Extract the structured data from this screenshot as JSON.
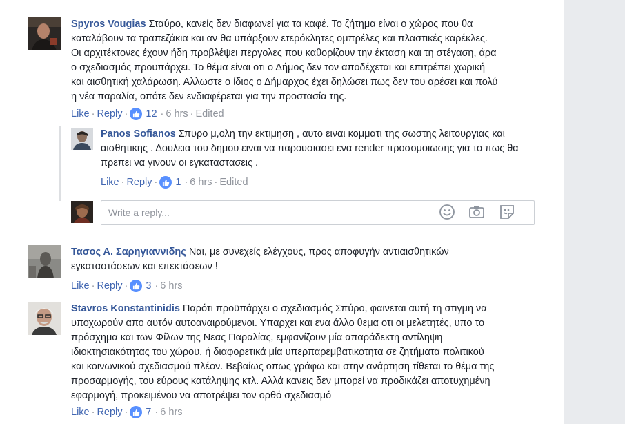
{
  "comments": [
    {
      "author": "Spyros Vougias",
      "text": "Σταύρο, κανείς δεν διαφωνεί για τα καφέ. Το ζήτημα είναι ο χώρος που θα καταλάβουν τα τραπεζάκια και αν θα υπάρξουν ετερόκλητες ομπρέλες και πλαστικές καρέκλες. Οι αρχιτέκτονες έχουν ήδη προβλέψει περγολες που καθορίζουν την έκταση και τη στέγαση, άρα ο σχεδιασμός προυπάρχει. Το θέμα είναι οτι ο Δήμος δεν τον αποδέχεται και επιτρέπει χωρική και αισθητική χαλάρωση. Αλλωστε ο ίδιος ο Δήμαρχος έχει δηλώσει πως δεν του αρέσει και πολύ η νέα παραλία, οπότε δεν ενδιαφέρεται για την προστασία της.",
      "like": "Like",
      "reply": "Reply",
      "likes": "12",
      "time": "6 hrs",
      "edited": "Edited"
    },
    {
      "author": "Panos Sofianos",
      "text": "Σπυρο μ,ολη την εκτιμηση , αυτο ειναι κομματι της σωστης λειτουργιας και αισθητικης . Δουλεια του δημου ειναι να παρουσιασει ενα render προσομοιωσης για το πως θα πρεπει να γινουν οι εγκαταστασεις .",
      "like": "Like",
      "reply": "Reply",
      "likes": "1",
      "time": "6 hrs",
      "edited": "Edited"
    },
    {
      "author": "Τασος Α. Σαρηγιαννιδης",
      "text": "Ναι, με συνεχείς ελέγχους, προς αποφυγήν αντιαισθητικών εγκαταστάσεων και επεκτάσεων !",
      "like": "Like",
      "reply": "Reply",
      "likes": "3",
      "time": "6 hrs"
    },
    {
      "author": "Stavros Konstantinidis",
      "text": "Παρότι προϋπάρχει ο σχεδιασμός Σπύρο, φαινεται αυτή τη στιγμη να υποχωρούν απο αυτόν αυτοαναιρούμενοι. Υπαρχει και ενα άλλο θεμα οτι οι μελετητές, υπο το πρόσχημα και των Φίλων της Νεας Παραλίας, εμφανίζουν μία απαράδεκτη αντίληψη ιδιοκτησιακότητας του χώρου, ή διαφορετικά μία υπερπαρεμβατικοτητα σε ζητήματα πολιτικού και κοινωνικού σχεδιασμού πλέον. Βεβαίως οπως γράφω και στην ανάρτηση τίθεται το θέμα της προσαρμογής, του εύρους κατάληψης κτλ. Αλλά κανεις δεν μπορεί να προδικάζει αποτυχημένη εφαρμογή, προκειμένου να αποτρέψει τον ορθό σχεδιασμό",
      "like": "Like",
      "reply": "Reply",
      "likes": "7",
      "time": "6 hrs"
    }
  ],
  "reply_box": {
    "placeholder": "Write a reply...",
    "icons": [
      "emoji-icon",
      "camera-icon",
      "sticker-icon"
    ]
  },
  "colors": {
    "author": "#365899",
    "link": "#4267b2",
    "meta": "#90949c",
    "like_badge": "#5890ff"
  }
}
